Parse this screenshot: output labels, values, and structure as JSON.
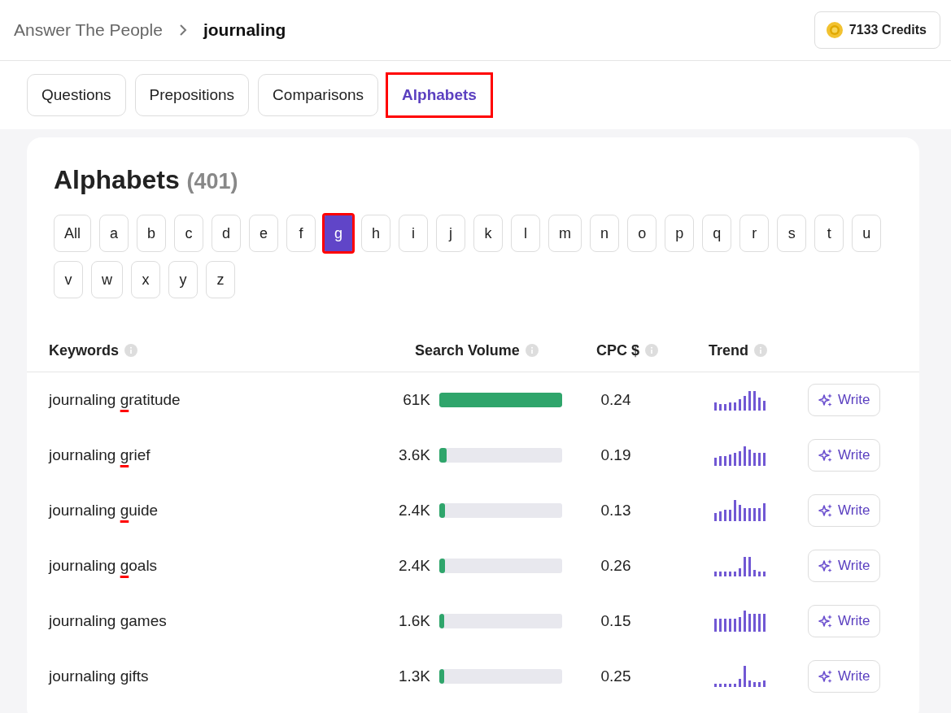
{
  "breadcrumb": {
    "root": "Answer The People",
    "current": "journaling"
  },
  "credits": {
    "label": "7133 Credits"
  },
  "tabs": [
    {
      "label": "Questions",
      "selected": false,
      "annotated": false
    },
    {
      "label": "Prepositions",
      "selected": false,
      "annotated": false
    },
    {
      "label": "Comparisons",
      "selected": false,
      "annotated": false
    },
    {
      "label": "Alphabets",
      "selected": true,
      "annotated": true
    }
  ],
  "section": {
    "title": "Alphabets",
    "count": "(401)"
  },
  "letters": [
    {
      "label": "All",
      "selected": false,
      "annotated": false
    },
    {
      "label": "a",
      "selected": false,
      "annotated": false
    },
    {
      "label": "b",
      "selected": false,
      "annotated": false
    },
    {
      "label": "c",
      "selected": false,
      "annotated": false
    },
    {
      "label": "d",
      "selected": false,
      "annotated": false
    },
    {
      "label": "e",
      "selected": false,
      "annotated": false
    },
    {
      "label": "f",
      "selected": false,
      "annotated": false
    },
    {
      "label": "g",
      "selected": true,
      "annotated": true
    },
    {
      "label": "h",
      "selected": false,
      "annotated": false
    },
    {
      "label": "i",
      "selected": false,
      "annotated": false
    },
    {
      "label": "j",
      "selected": false,
      "annotated": false
    },
    {
      "label": "k",
      "selected": false,
      "annotated": false
    },
    {
      "label": "l",
      "selected": false,
      "annotated": false
    },
    {
      "label": "m",
      "selected": false,
      "annotated": false
    },
    {
      "label": "n",
      "selected": false,
      "annotated": false
    },
    {
      "label": "o",
      "selected": false,
      "annotated": false
    },
    {
      "label": "p",
      "selected": false,
      "annotated": false
    },
    {
      "label": "q",
      "selected": false,
      "annotated": false
    },
    {
      "label": "r",
      "selected": false,
      "annotated": false
    },
    {
      "label": "s",
      "selected": false,
      "annotated": false
    },
    {
      "label": "t",
      "selected": false,
      "annotated": false
    },
    {
      "label": "u",
      "selected": false,
      "annotated": false
    },
    {
      "label": "v",
      "selected": false,
      "annotated": false
    },
    {
      "label": "w",
      "selected": false,
      "annotated": false
    },
    {
      "label": "x",
      "selected": false,
      "annotated": false
    },
    {
      "label": "y",
      "selected": false,
      "annotated": false
    },
    {
      "label": "z",
      "selected": false,
      "annotated": false
    }
  ],
  "table": {
    "columns": [
      "Keywords",
      "Search Volume",
      "CPC $",
      "Trend"
    ],
    "rows": [
      {
        "keyword": "journaling gratitude",
        "annotated": true,
        "volume": "61K",
        "level": 1,
        "cpc": "0.24",
        "action": "Write"
      },
      {
        "keyword": "journaling grief",
        "annotated": true,
        "volume": "3.6K",
        "level": 0.06,
        "cpc": "0.19",
        "action": "Write"
      },
      {
        "keyword": "journaling guide",
        "annotated": true,
        "volume": "2.4K",
        "level": 0.045,
        "cpc": "0.13",
        "action": "Write"
      },
      {
        "keyword": "journaling goals",
        "annotated": true,
        "volume": "2.4K",
        "level": 0.045,
        "cpc": "0.26",
        "action": "Write"
      },
      {
        "keyword": "journaling games",
        "annotated": false,
        "volume": "1.6K",
        "level": 0.03,
        "cpc": "0.15",
        "action": "Write"
      },
      {
        "keyword": "journaling gifts",
        "annotated": false,
        "volume": "1.3K",
        "level": 0.025,
        "cpc": "0.25",
        "action": "Write"
      }
    ]
  }
}
